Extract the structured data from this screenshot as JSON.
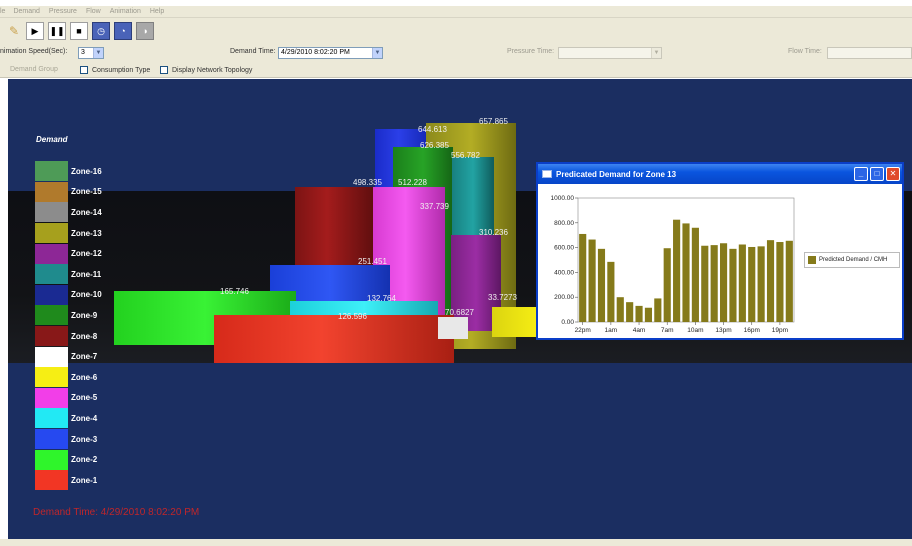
{
  "menu": [
    "le",
    "Demand",
    "Pressure",
    "Flow",
    "Animation",
    "Help"
  ],
  "controls": {
    "animation_speed_label": "nimation Speed(Sec):",
    "animation_speed_value": "3",
    "demand_time_label": "Demand Time:",
    "demand_time_value": "4/29/2010 8:02:20 PM",
    "pressure_time_label": "Pressure Time:",
    "flow_time_label": "Flow Time:"
  },
  "checks": {
    "demand_group": "Demand Group",
    "consumption_type": "Consumption Type",
    "display_network_topology": "Display Network Topology"
  },
  "legend": {
    "title": "Demand",
    "zones": [
      {
        "label": "Zone-16",
        "color": "#4e9b57"
      },
      {
        "label": "Zone-15",
        "color": "#b07a2c"
      },
      {
        "label": "Zone-14",
        "color": "#8c8c8c"
      },
      {
        "label": "Zone-13",
        "color": "#a6a01d"
      },
      {
        "label": "Zone-12",
        "color": "#8d2796"
      },
      {
        "label": "Zone-11",
        "color": "#1f8b8d"
      },
      {
        "label": "Zone-10",
        "color": "#1a2a92"
      },
      {
        "label": "Zone-9",
        "color": "#1f8a1c"
      },
      {
        "label": "Zone-8",
        "color": "#881818"
      },
      {
        "label": "Zone-7",
        "color": "#ffffff"
      },
      {
        "label": "Zone-6",
        "color": "#f6ee14"
      },
      {
        "label": "Zone-5",
        "color": "#f23ee8"
      },
      {
        "label": "Zone-4",
        "color": "#22e9f4"
      },
      {
        "label": "Zone-3",
        "color": "#2649f0"
      },
      {
        "label": "Zone-2",
        "color": "#2ff52b"
      },
      {
        "label": "Zone-1",
        "color": "#f23624"
      }
    ]
  },
  "bar_values": [
    "657.865",
    "644.613",
    "626.385",
    "556.782",
    "498.335",
    "512.228",
    "337.739",
    "310.236",
    "251.451",
    "165.746",
    "132.764",
    "126.596",
    "70.6827",
    "33.7273"
  ],
  "demand_time_overlay": "Demand Time: 4/29/2010 8:02:20 PM",
  "window": {
    "title": "Predicated Demand for Zone 13",
    "min_icon": "minimize-icon",
    "max_icon": "maximize-icon",
    "close_icon": "close-icon"
  },
  "chart_data": {
    "type": "bar",
    "title": "",
    "xlabel": "",
    "ylabel": "",
    "ylim": [
      0,
      1000
    ],
    "y_ticks": [
      "0.00",
      "200.00",
      "400.00",
      "600.00",
      "800.00",
      "1000.00"
    ],
    "x_tick_labels": [
      "22pm",
      "1am",
      "4am",
      "7am",
      "10am",
      "13pm",
      "16pm",
      "19pm"
    ],
    "series": [
      {
        "name": "Predicted Demand / CMH",
        "color": "#857a1a",
        "values": [
          710,
          665,
          590,
          485,
          200,
          160,
          130,
          115,
          190,
          595,
          825,
          795,
          760,
          615,
          620,
          635,
          590,
          625,
          605,
          610,
          660,
          645,
          655
        ]
      }
    ],
    "grid": false,
    "legend_position": "right"
  }
}
